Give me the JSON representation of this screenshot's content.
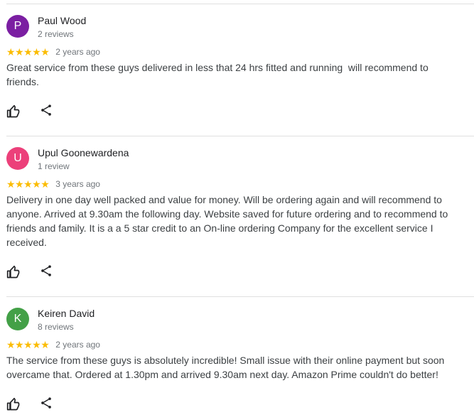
{
  "reviews": [
    {
      "initial": "P",
      "avatar_color": "#7b1fa2",
      "name": "Paul Wood",
      "review_count": "2 reviews",
      "stars": "★★★★★",
      "date": "2 years ago",
      "text": "Great service from these guys delivered in less that 24 hrs fitted and running  will recommend to friends."
    },
    {
      "initial": "U",
      "avatar_color": "#ec407a",
      "name": "Upul Goonewardena",
      "review_count": "1 review",
      "stars": "★★★★★",
      "date": "3 years ago",
      "text": "Delivery in one day well packed and value for money. Will be ordering again and will recommend to anyone. Arrived at 9.30am the following day. Website saved for future ordering and to recommend to friends and family. It is a a 5 star credit to an On-line ordering Company for the excellent service I received."
    },
    {
      "initial": "K",
      "avatar_color": "#43a047",
      "name": "Keiren David",
      "review_count": "8 reviews",
      "stars": "★★★★★",
      "date": "2 years ago",
      "text": "The service from these guys is absolutely incredible! Small issue with their online payment but soon overcame that. Ordered at 1.30pm and arrived 9.30am next day. Amazon Prime couldn't do better!"
    }
  ],
  "icons": {
    "like": "thumb-up-icon",
    "share": "share-icon"
  }
}
